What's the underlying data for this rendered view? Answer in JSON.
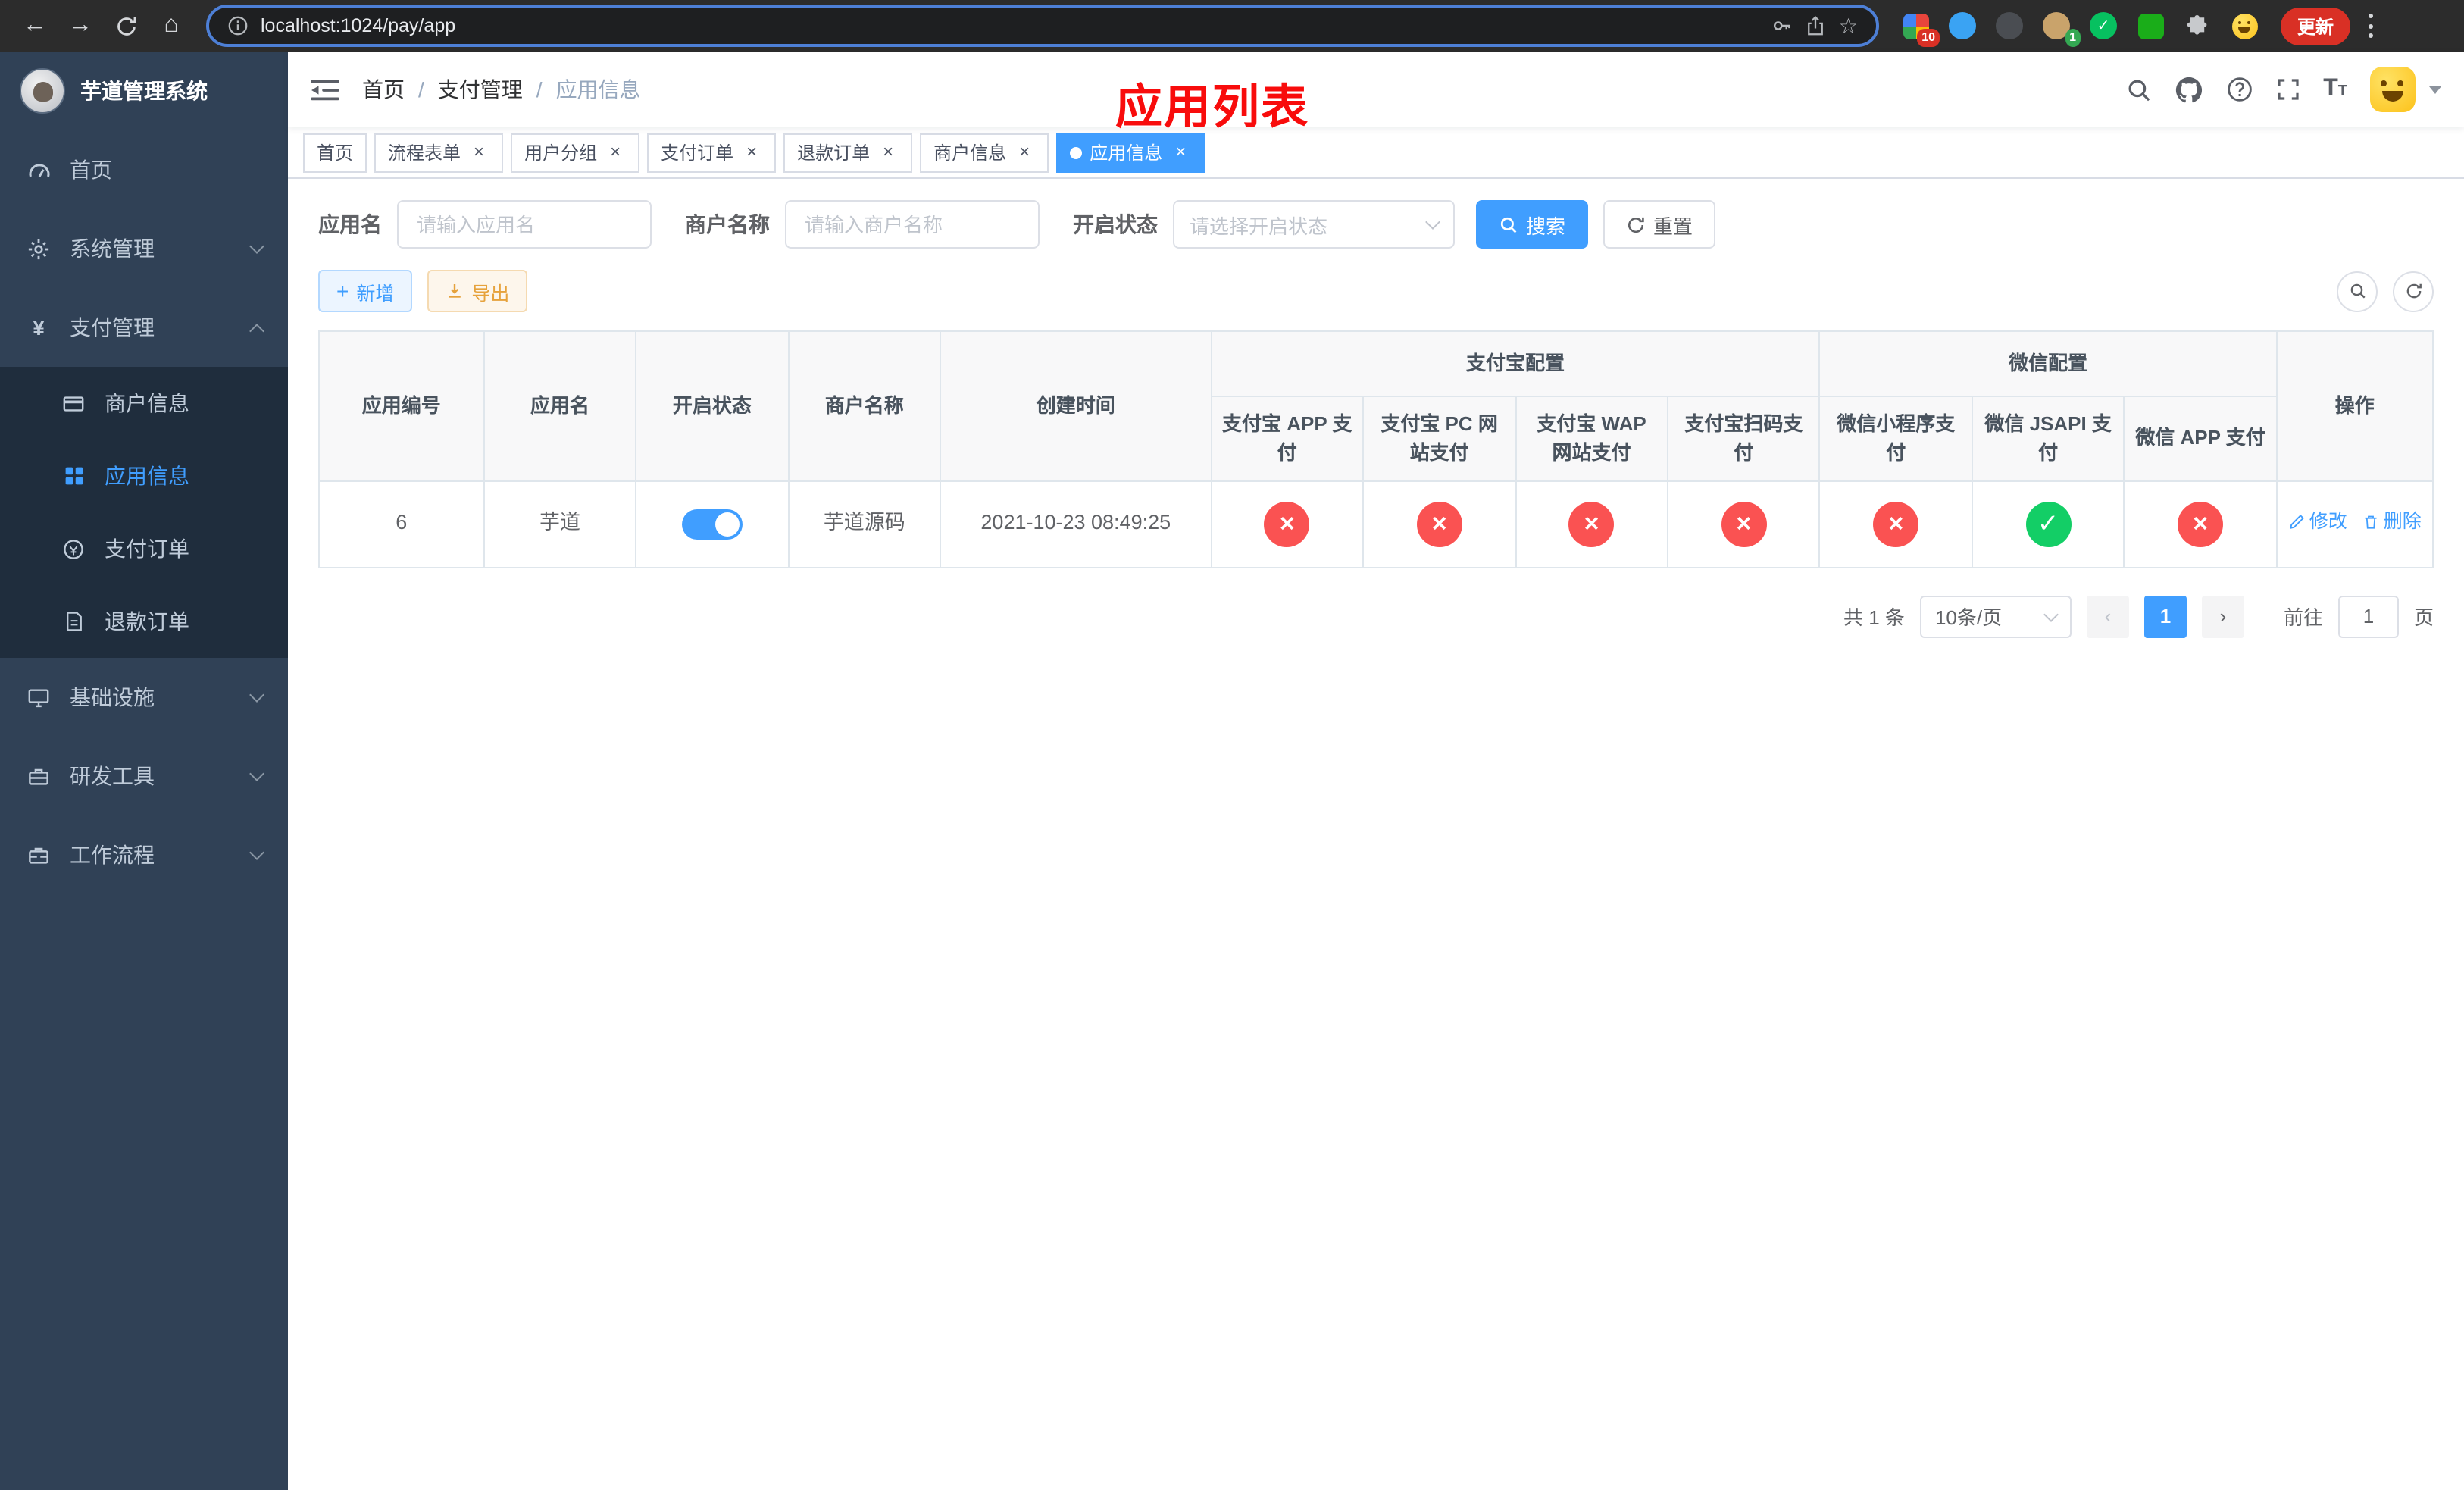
{
  "colors": {
    "primary": "#409eff",
    "success": "#13ce66",
    "danger": "#fa5252",
    "warning": "#e6a23c",
    "sidebar_bg": "#304156",
    "submenu_bg": "#1f2d3d",
    "overlay_title_red": "#f80c0c"
  },
  "browser": {
    "url": "localhost:1024/pay/app",
    "update_label": "更新",
    "ext_badge_1": "10",
    "ext_badge_2": "1"
  },
  "sidebar": {
    "logo_title": "芋道管理系统",
    "items": [
      {
        "label": "首页"
      },
      {
        "label": "系统管理"
      },
      {
        "label": "支付管理"
      },
      {
        "label": "基础设施"
      },
      {
        "label": "研发工具"
      },
      {
        "label": "工作流程"
      }
    ],
    "submenu": [
      {
        "label": "商户信息"
      },
      {
        "label": "应用信息"
      },
      {
        "label": "支付订单"
      },
      {
        "label": "退款订单"
      }
    ]
  },
  "navbar": {
    "breadcrumb": {
      "home": "首页",
      "section": "支付管理",
      "page": "应用信息"
    },
    "overlay_title": "应用列表"
  },
  "tabs": [
    {
      "label": "首页"
    },
    {
      "label": "流程表单"
    },
    {
      "label": "用户分组"
    },
    {
      "label": "支付订单"
    },
    {
      "label": "退款订单"
    },
    {
      "label": "商户信息"
    },
    {
      "label": "应用信息"
    }
  ],
  "filters": {
    "app_name_label": "应用名",
    "app_name_placeholder": "请输入应用名",
    "merchant_label": "商户名称",
    "merchant_placeholder": "请输入商户名称",
    "status_label": "开启状态",
    "status_placeholder": "请选择开启状态",
    "search_label": "搜索",
    "reset_label": "重置"
  },
  "toolbar": {
    "add_label": "新增",
    "export_label": "导出"
  },
  "table": {
    "headers": {
      "app_id": "应用编号",
      "app_name": "应用名",
      "status": "开启状态",
      "merchant": "商户名称",
      "created": "创建时间",
      "alipay_group": "支付宝配置",
      "wechat_group": "微信配置",
      "alipay_app": "支付宝 APP 支付",
      "alipay_pc": "支付宝 PC 网站支付",
      "alipay_wap": "支付宝 WAP 网站支付",
      "alipay_qr": "支付宝扫码支付",
      "wx_mini": "微信小程序支付",
      "wx_jsapi": "微信 JSAPI 支付",
      "wx_app": "微信 APP 支付",
      "actions": "操作"
    },
    "row": {
      "id": "6",
      "name": "芋道",
      "status_on": true,
      "merchant": "芋道源码",
      "created": "2021-10-23 08:49:25",
      "channels": [
        "no",
        "no",
        "no",
        "no",
        "no",
        "yes",
        "no"
      ],
      "edit": "修改",
      "delete": "删除"
    }
  },
  "pagination": {
    "total": "共 1 条",
    "page_size": "10条/页",
    "page": "1",
    "goto": "前往",
    "goto_value": "1",
    "unit": "页"
  }
}
